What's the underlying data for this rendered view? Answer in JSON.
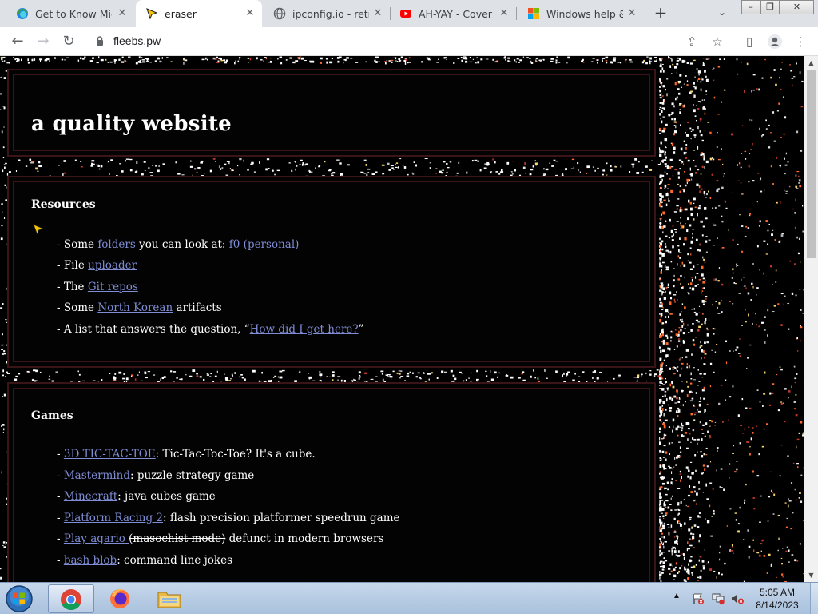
{
  "browser": {
    "tabs": [
      {
        "title": "Get to Know Micr",
        "icon": "edge-icon",
        "active": false
      },
      {
        "title": "eraser",
        "icon": "cursor-favicon-icon",
        "active": true
      },
      {
        "title": "ipconfig.io - retrie",
        "icon": "globe-icon",
        "active": false
      },
      {
        "title": "AH-YAY - Cover b",
        "icon": "youtube-icon",
        "active": false
      },
      {
        "title": "Windows help & l",
        "icon": "microsoft-icon",
        "active": false
      }
    ],
    "url": "fleebs.pw"
  },
  "page": {
    "title": "a quality website",
    "resources": {
      "heading": "Resources",
      "items": [
        {
          "prefix": "- Some ",
          "link1": "folders",
          "mid": " you can look at: ",
          "link2": "f0",
          "gap": " ",
          "link3": "(personal)"
        },
        {
          "prefix": "- File ",
          "link": "uploader",
          "suffix": ""
        },
        {
          "prefix": "- The ",
          "link": "Git repos",
          "suffix": ""
        },
        {
          "prefix": "- Some ",
          "link": "North Korean",
          "suffix": " artifacts"
        },
        {
          "prefix": "- A list that answers the question, “",
          "link": "How did I get here?",
          "suffix": "”"
        }
      ]
    },
    "games": {
      "heading": "Games",
      "items": [
        {
          "prefix": "- ",
          "link": "3D TIC-TAC-TOE",
          "suffix": ": Tic-Tac-Toc-Toe? It's a cube."
        },
        {
          "prefix": "- ",
          "link": "Mastermind",
          "suffix": ": puzzle strategy game"
        },
        {
          "prefix": "- ",
          "link": "Minecraft",
          "suffix": ": java cubes game"
        },
        {
          "prefix": "- ",
          "link": "Platform Racing 2",
          "suffix": ": flash precision platformer speedrun game"
        },
        {
          "prefix": "- ",
          "link": "Play agario ",
          "strike": "(masochist mode)",
          "suffix": " defunct in modern browsers"
        },
        {
          "prefix": "- ",
          "link": "bash blob",
          "suffix": ": command line jokes"
        }
      ]
    }
  },
  "taskbar": {
    "apps": [
      "chrome-icon",
      "firefox-icon",
      "file-explorer-icon"
    ],
    "time": "5:05 AM",
    "date": "8/14/2023"
  },
  "colors": {
    "link": "#7f8dd4",
    "panel_border": "#3a1416",
    "background": "#000000"
  }
}
